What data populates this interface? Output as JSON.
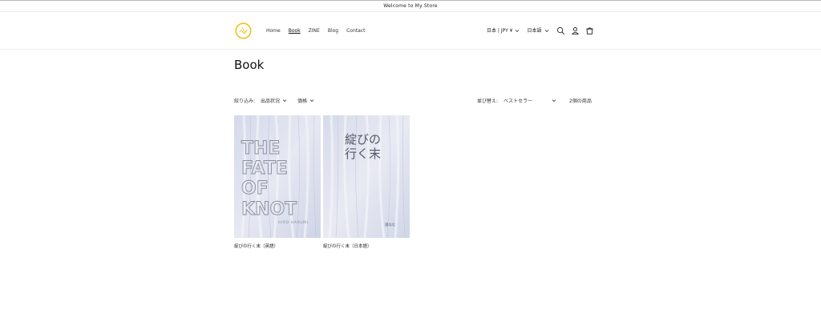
{
  "announcement": {
    "text": "Welcome to My Store"
  },
  "header": {
    "nav": [
      {
        "label": "Home"
      },
      {
        "label": "Book"
      },
      {
        "label": "ZINE"
      },
      {
        "label": "Blog"
      },
      {
        "label": "Contact"
      }
    ],
    "active_nav": "Book",
    "country_selector": "日本 | JPY ¥",
    "language_selector": "日本語"
  },
  "page_title": "Book",
  "filters": {
    "label": "絞り込み:",
    "availability": "出品状況",
    "price": "価格"
  },
  "sort": {
    "label": "並び替え:",
    "selected": "ベストセラー"
  },
  "product_count": "2個の商品",
  "products": [
    {
      "title": "綻びの行く末（英語）",
      "cover_text": [
        "THE",
        "FATE",
        "OF",
        "KNOT"
      ],
      "cover_author": "HIRO HARUMI"
    },
    {
      "title": "綻びの行く末（日本語）",
      "cover_text": [
        "綻びの",
        "行く末"
      ],
      "cover_author": "遥なむ"
    }
  ],
  "colors": {
    "logo": "#f2c317",
    "text": "#121212",
    "border": "#ececec"
  }
}
